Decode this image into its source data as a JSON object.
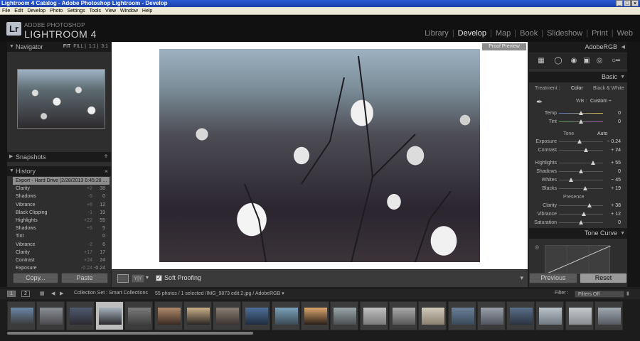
{
  "window": {
    "title": "Lightroom 4 Catalog - Adobe Photoshop Lightroom - Develop",
    "min_glyph": "_",
    "max_glyph": "□",
    "close_glyph": "×"
  },
  "menu": [
    "File",
    "Edit",
    "Develop",
    "Photo",
    "Settings",
    "Tools",
    "View",
    "Window",
    "Help"
  ],
  "brand": {
    "logo": "Lr",
    "small": "ADOBE PHOTOSHOP",
    "big": "LIGHTROOM 4"
  },
  "modules": [
    "Library",
    "Develop",
    "Map",
    "Book",
    "Slideshow",
    "Print",
    "Web"
  ],
  "active_module": "Develop",
  "left": {
    "navigator": {
      "title": "Navigator",
      "fit": "FIT",
      "fill": "FILL",
      "one": "1:1",
      "three": "3:1"
    },
    "snapshots": {
      "title": "Snapshots",
      "add": "+"
    },
    "history": {
      "title": "History",
      "close": "×",
      "items": [
        {
          "label": "Export - Hard Drive (2/28/2013 6:45:28 ...",
          "v1": "",
          "v2": ""
        },
        {
          "label": "Clarity",
          "v1": "+2",
          "v2": "38"
        },
        {
          "label": "Shadows",
          "v1": "-5",
          "v2": "0"
        },
        {
          "label": "Vibrance",
          "v1": "+6",
          "v2": "12"
        },
        {
          "label": "Black Clipping",
          "v1": "-1",
          "v2": "19"
        },
        {
          "label": "Highlights",
          "v1": "+22",
          "v2": "55"
        },
        {
          "label": "Shadows",
          "v1": "+5",
          "v2": "5"
        },
        {
          "label": "Tint",
          "v1": "",
          "v2": "0"
        },
        {
          "label": "Vibrance",
          "v1": "-2",
          "v2": "6"
        },
        {
          "label": "Clarity",
          "v1": "+17",
          "v2": "17"
        },
        {
          "label": "Contrast",
          "v1": "+24",
          "v2": "24"
        },
        {
          "label": "Exposure",
          "v1": "-0.24",
          "v2": "-0.24"
        }
      ]
    },
    "copy_label": "Copy...",
    "paste_label": "Paste"
  },
  "center": {
    "proof_preview": "Proof Preview",
    "soft_proofing": "Soft Proofing",
    "check": "✓",
    "view_yy": "Y|Y",
    "caret": "▾",
    "arrow": "▾"
  },
  "right": {
    "profile": "AdobeRGB",
    "basic_title": "Basic",
    "treatment_label": "Treatment :",
    "treatment_color": "Color",
    "treatment_bw": "Black & White",
    "wb_label": "WB :",
    "wb_value": "Custom ÷",
    "tone_label": "Tone",
    "auto_label": "Auto",
    "presence_label": "Presence",
    "tone_curve_title": "Tone Curve",
    "sliders": [
      {
        "label": "Temp",
        "value": "0",
        "pos": 0.5
      },
      {
        "label": "Tint",
        "value": "0",
        "pos": 0.5
      },
      {
        "label": "Exposure",
        "value": "− 0.24",
        "pos": 0.47
      },
      {
        "label": "Contrast",
        "value": "+ 24",
        "pos": 0.62
      },
      {
        "label": "Highlights",
        "value": "+ 55",
        "pos": 0.77
      },
      {
        "label": "Shadows",
        "value": "0",
        "pos": 0.5
      },
      {
        "label": "Whites",
        "value": "− 45",
        "pos": 0.27
      },
      {
        "label": "Blacks",
        "value": "+ 19",
        "pos": 0.6
      },
      {
        "label": "Clarity",
        "value": "+ 38",
        "pos": 0.69
      },
      {
        "label": "Vibrance",
        "value": "+ 12",
        "pos": 0.56
      },
      {
        "label": "Saturation",
        "value": "0",
        "pos": 0.5
      }
    ],
    "previous_label": "Previous",
    "reset_label": "Reset"
  },
  "filmbar": {
    "page1": "1",
    "page2": "2",
    "source": "Collection Set : Smart Collections",
    "info": "55 photos / 1 selected /IMG_9873 edit 2.jpg / AdobeRGB ▾",
    "filter_label": "Filter :",
    "filter_value": "Filters Off"
  },
  "filmstrip_count": 21,
  "filmstrip_selected": 3,
  "colors": {
    "accent": "#e8e8e8",
    "panel": "#2e2e2e",
    "header": "#111111"
  }
}
